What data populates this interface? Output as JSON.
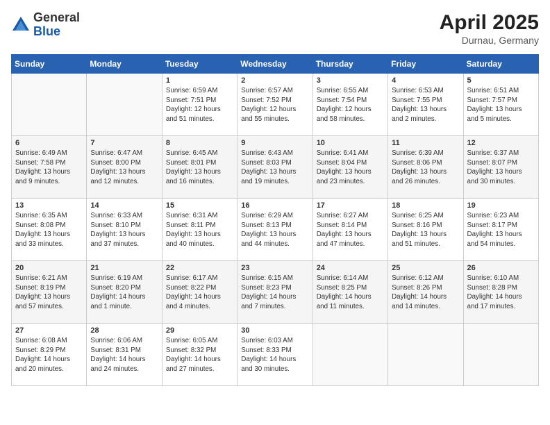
{
  "logo": {
    "general": "General",
    "blue": "Blue"
  },
  "title": {
    "month_year": "April 2025",
    "location": "Durnau, Germany"
  },
  "days_of_week": [
    "Sunday",
    "Monday",
    "Tuesday",
    "Wednesday",
    "Thursday",
    "Friday",
    "Saturday"
  ],
  "weeks": [
    [
      {
        "num": "",
        "info": ""
      },
      {
        "num": "",
        "info": ""
      },
      {
        "num": "1",
        "info": "Sunrise: 6:59 AM\nSunset: 7:51 PM\nDaylight: 12 hours and 51 minutes."
      },
      {
        "num": "2",
        "info": "Sunrise: 6:57 AM\nSunset: 7:52 PM\nDaylight: 12 hours and 55 minutes."
      },
      {
        "num": "3",
        "info": "Sunrise: 6:55 AM\nSunset: 7:54 PM\nDaylight: 12 hours and 58 minutes."
      },
      {
        "num": "4",
        "info": "Sunrise: 6:53 AM\nSunset: 7:55 PM\nDaylight: 13 hours and 2 minutes."
      },
      {
        "num": "5",
        "info": "Sunrise: 6:51 AM\nSunset: 7:57 PM\nDaylight: 13 hours and 5 minutes."
      }
    ],
    [
      {
        "num": "6",
        "info": "Sunrise: 6:49 AM\nSunset: 7:58 PM\nDaylight: 13 hours and 9 minutes."
      },
      {
        "num": "7",
        "info": "Sunrise: 6:47 AM\nSunset: 8:00 PM\nDaylight: 13 hours and 12 minutes."
      },
      {
        "num": "8",
        "info": "Sunrise: 6:45 AM\nSunset: 8:01 PM\nDaylight: 13 hours and 16 minutes."
      },
      {
        "num": "9",
        "info": "Sunrise: 6:43 AM\nSunset: 8:03 PM\nDaylight: 13 hours and 19 minutes."
      },
      {
        "num": "10",
        "info": "Sunrise: 6:41 AM\nSunset: 8:04 PM\nDaylight: 13 hours and 23 minutes."
      },
      {
        "num": "11",
        "info": "Sunrise: 6:39 AM\nSunset: 8:06 PM\nDaylight: 13 hours and 26 minutes."
      },
      {
        "num": "12",
        "info": "Sunrise: 6:37 AM\nSunset: 8:07 PM\nDaylight: 13 hours and 30 minutes."
      }
    ],
    [
      {
        "num": "13",
        "info": "Sunrise: 6:35 AM\nSunset: 8:08 PM\nDaylight: 13 hours and 33 minutes."
      },
      {
        "num": "14",
        "info": "Sunrise: 6:33 AM\nSunset: 8:10 PM\nDaylight: 13 hours and 37 minutes."
      },
      {
        "num": "15",
        "info": "Sunrise: 6:31 AM\nSunset: 8:11 PM\nDaylight: 13 hours and 40 minutes."
      },
      {
        "num": "16",
        "info": "Sunrise: 6:29 AM\nSunset: 8:13 PM\nDaylight: 13 hours and 44 minutes."
      },
      {
        "num": "17",
        "info": "Sunrise: 6:27 AM\nSunset: 8:14 PM\nDaylight: 13 hours and 47 minutes."
      },
      {
        "num": "18",
        "info": "Sunrise: 6:25 AM\nSunset: 8:16 PM\nDaylight: 13 hours and 51 minutes."
      },
      {
        "num": "19",
        "info": "Sunrise: 6:23 AM\nSunset: 8:17 PM\nDaylight: 13 hours and 54 minutes."
      }
    ],
    [
      {
        "num": "20",
        "info": "Sunrise: 6:21 AM\nSunset: 8:19 PM\nDaylight: 13 hours and 57 minutes."
      },
      {
        "num": "21",
        "info": "Sunrise: 6:19 AM\nSunset: 8:20 PM\nDaylight: 14 hours and 1 minute."
      },
      {
        "num": "22",
        "info": "Sunrise: 6:17 AM\nSunset: 8:22 PM\nDaylight: 14 hours and 4 minutes."
      },
      {
        "num": "23",
        "info": "Sunrise: 6:15 AM\nSunset: 8:23 PM\nDaylight: 14 hours and 7 minutes."
      },
      {
        "num": "24",
        "info": "Sunrise: 6:14 AM\nSunset: 8:25 PM\nDaylight: 14 hours and 11 minutes."
      },
      {
        "num": "25",
        "info": "Sunrise: 6:12 AM\nSunset: 8:26 PM\nDaylight: 14 hours and 14 minutes."
      },
      {
        "num": "26",
        "info": "Sunrise: 6:10 AM\nSunset: 8:28 PM\nDaylight: 14 hours and 17 minutes."
      }
    ],
    [
      {
        "num": "27",
        "info": "Sunrise: 6:08 AM\nSunset: 8:29 PM\nDaylight: 14 hours and 20 minutes."
      },
      {
        "num": "28",
        "info": "Sunrise: 6:06 AM\nSunset: 8:31 PM\nDaylight: 14 hours and 24 minutes."
      },
      {
        "num": "29",
        "info": "Sunrise: 6:05 AM\nSunset: 8:32 PM\nDaylight: 14 hours and 27 minutes."
      },
      {
        "num": "30",
        "info": "Sunrise: 6:03 AM\nSunset: 8:33 PM\nDaylight: 14 hours and 30 minutes."
      },
      {
        "num": "",
        "info": ""
      },
      {
        "num": "",
        "info": ""
      },
      {
        "num": "",
        "info": ""
      }
    ]
  ]
}
